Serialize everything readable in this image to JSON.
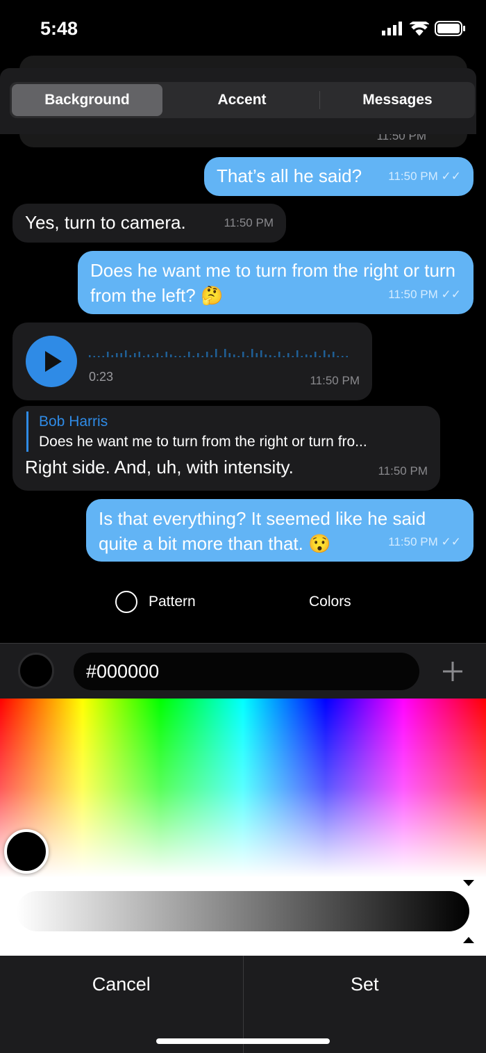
{
  "status": {
    "time": "5:48"
  },
  "tabs": [
    {
      "label": "Background",
      "active": true
    },
    {
      "label": "Accent"
    },
    {
      "label": "Messages"
    }
  ],
  "ghost_time": "11:50 PM",
  "messages": [
    {
      "dir": "out",
      "text": "That’s all he said?",
      "time": "11:50 PM"
    },
    {
      "dir": "in",
      "text": "Yes, turn to camera.",
      "time": "11:50 PM"
    },
    {
      "dir": "out",
      "text": "Does he want me to turn from the right or turn from the left? 🤔",
      "time": "11:50 PM"
    },
    {
      "dir": "in",
      "type": "voice",
      "duration": "0:23",
      "time": "11:50 PM"
    },
    {
      "dir": "in",
      "reply_name": "Bob Harris",
      "reply_text": "Does he want me to turn from the right or turn fro...",
      "text": "Right side. And, uh, with intensity.",
      "time": "11:50 PM"
    },
    {
      "dir": "out",
      "text": "Is that everything? It seemed like he said quite a bit more than that. 😯",
      "time": "11:50 PM"
    }
  ],
  "options": {
    "pattern": "Pattern",
    "colors": "Colors"
  },
  "picker": {
    "hex": "#000000",
    "selected_color": "#000000"
  },
  "buttons": {
    "cancel": "Cancel",
    "set": "Set"
  },
  "colors": {
    "outgoing": "#62b4f5",
    "incoming": "#1c1c1e",
    "accent": "#2f8be6"
  }
}
